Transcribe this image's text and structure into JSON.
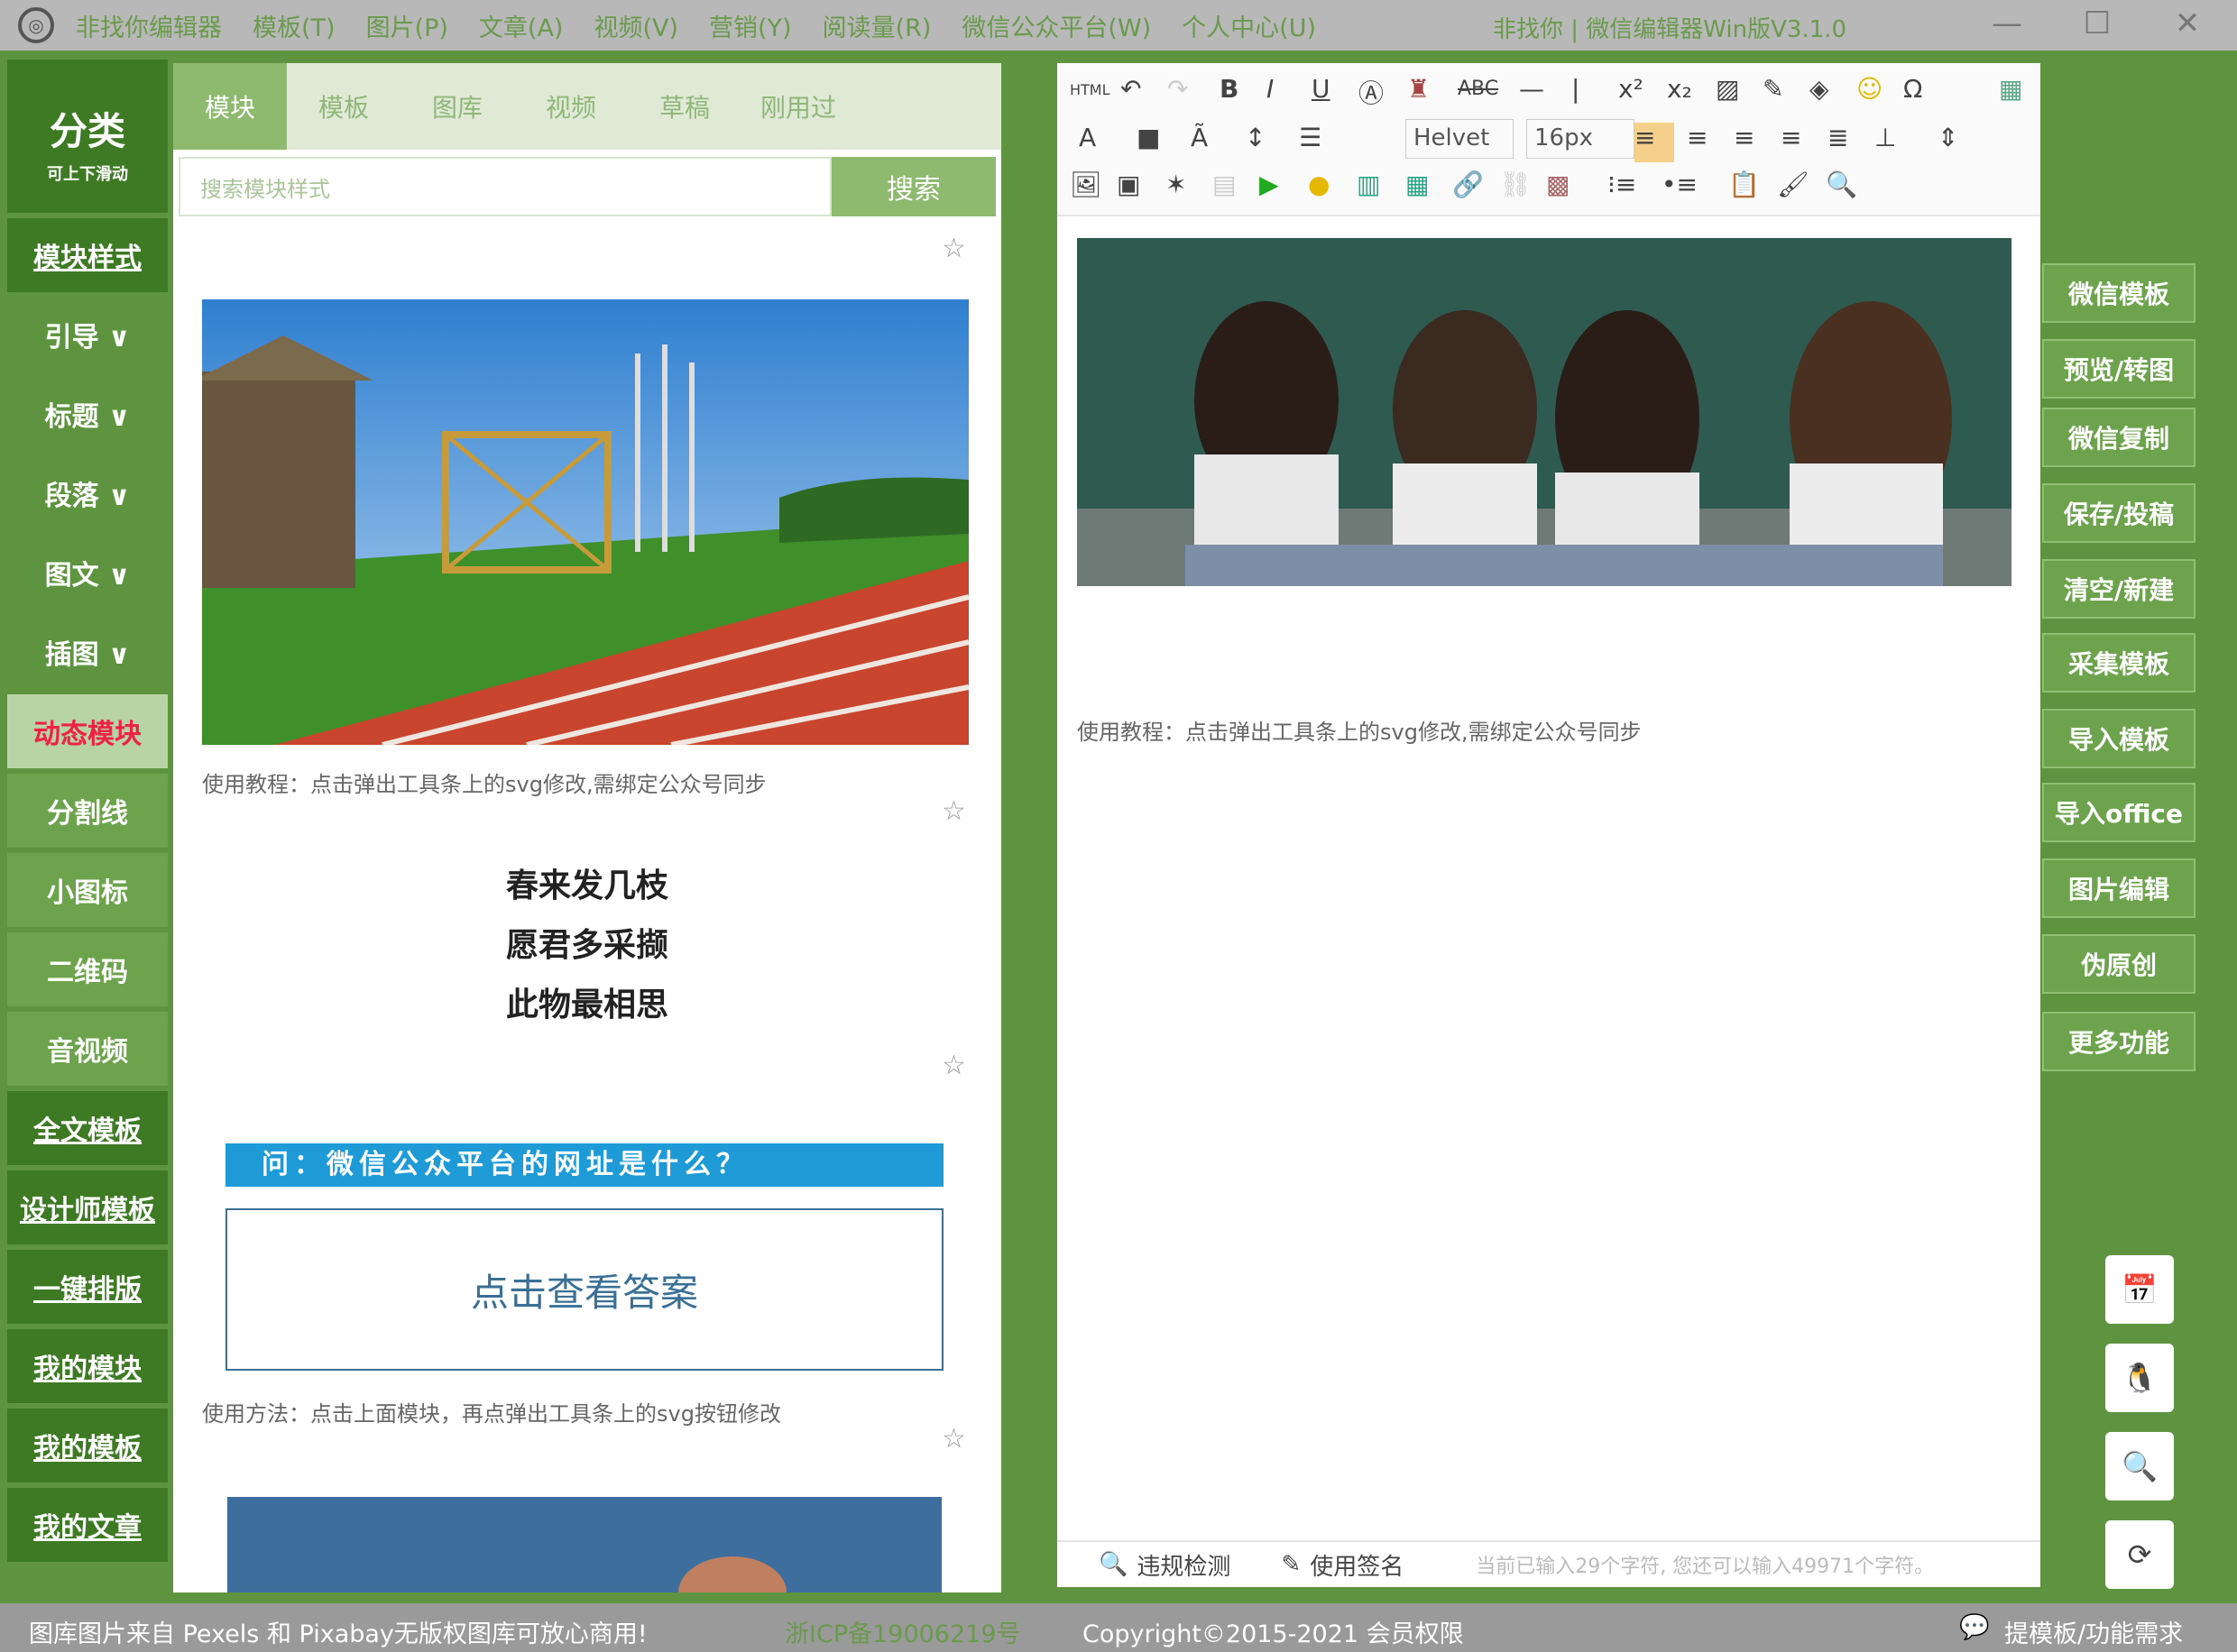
{
  "menubar": {
    "items": [
      "非找你编辑器",
      "模板(T)",
      "图片(P)",
      "文章(A)",
      "视频(V)",
      "营销(Y)",
      "阅读量(R)",
      "微信公众平台(W)",
      "个人中心(U)"
    ],
    "title": "非找你 | 微信编辑器Win版V3.1.0",
    "minimize": "—",
    "maximize": "☐",
    "close": "✕"
  },
  "sidebar": {
    "head_big": "分类",
    "head_small": "可上下滑动",
    "items": [
      "模块样式",
      "引导 ∨",
      "标题 ∨",
      "段落 ∨",
      "图文 ∨",
      "插图 ∨",
      "动态模块",
      "分割线",
      "小图标",
      "二维码",
      "音视频",
      "全文模板",
      "设计师模板",
      "一键排版",
      "我的模块",
      "我的模板",
      "我的文章"
    ]
  },
  "tabs": [
    "模块",
    "模板",
    "图库",
    "视频",
    "草稿",
    "刚用过"
  ],
  "search": {
    "placeholder": "搜索模块样式",
    "button": "搜索"
  },
  "blocks": {
    "caption1": "使用教程：点击弹出工具条上的svg修改,需绑定公众号同步",
    "poem": [
      "春来发几枝",
      "愿君多采撷",
      "此物最相思"
    ],
    "question": "问：微信公众平台的网址是什么？",
    "answer": "点击查看答案",
    "caption2": "使用方法：点击上面模块，再点弹出工具条上的svg按钮修改"
  },
  "toolbar": {
    "font": "Helvet",
    "size": "16px",
    "html": "HTML"
  },
  "editor": {
    "caption": "使用教程：点击弹出工具条上的svg修改,需绑定公众号同步",
    "check": "违规检测",
    "sign": "使用签名",
    "count": "当前已输入29个字符, 您还可以输入49971个字符。"
  },
  "right_buttons": [
    "微信模板",
    "预览/转图",
    "微信复制",
    "保存/投稿",
    "清空/新建",
    "采集模板",
    "导入模板",
    "导入office",
    "图片编辑",
    "伪原创",
    "更多功能"
  ],
  "status": {
    "left": "图库图片来自 Pexels 和 Pixabay无版权图库可放心商用!",
    "mid": "浙ICP备19006219号",
    "copyright": "Copyright©2015-2021 会员权限",
    "right": "提模板/功能需求"
  }
}
